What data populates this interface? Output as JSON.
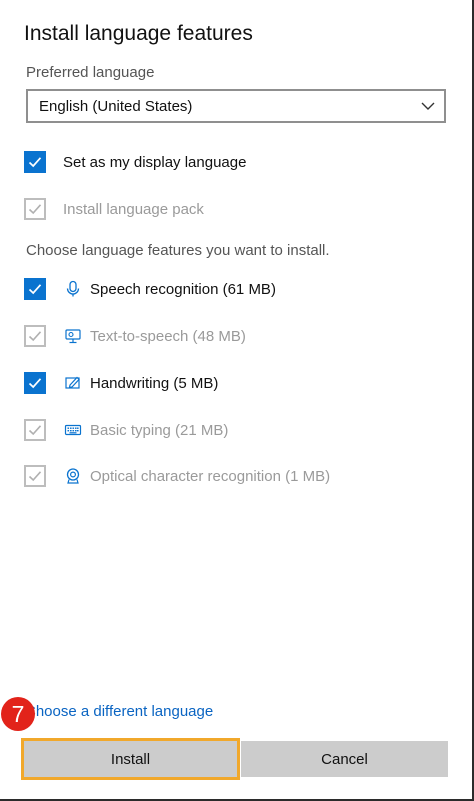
{
  "dialog": {
    "title": "Install language features",
    "preferred_label": "Preferred language",
    "preferred_value": "English (United States)",
    "options": [
      {
        "label": "Set as my display language",
        "checked": true,
        "disabled": false
      },
      {
        "label": "Install language pack",
        "checked": true,
        "disabled": true
      }
    ],
    "features_label": "Choose language features you want to install.",
    "features": [
      {
        "label": "Speech recognition (61 MB)",
        "checked": true,
        "disabled": false,
        "icon": "microphone-icon"
      },
      {
        "label": "Text-to-speech (48 MB)",
        "checked": true,
        "disabled": true,
        "icon": "text-to-speech-icon"
      },
      {
        "label": "Handwriting (5 MB)",
        "checked": true,
        "disabled": false,
        "icon": "pen-icon"
      },
      {
        "label": "Basic typing (21 MB)",
        "checked": true,
        "disabled": true,
        "icon": "keyboard-icon"
      },
      {
        "label": "Optical character recognition (1 MB)",
        "checked": true,
        "disabled": true,
        "icon": "ocr-icon"
      }
    ],
    "different_language_link": "Choose a different language",
    "install_label": "Install",
    "cancel_label": "Cancel"
  },
  "annotation": {
    "step_number": "7"
  },
  "colors": {
    "accent": "#0a73cf",
    "link": "#0a64c2",
    "highlight": "#f1a82b",
    "badge": "#e2231a",
    "button": "#cccccc"
  }
}
